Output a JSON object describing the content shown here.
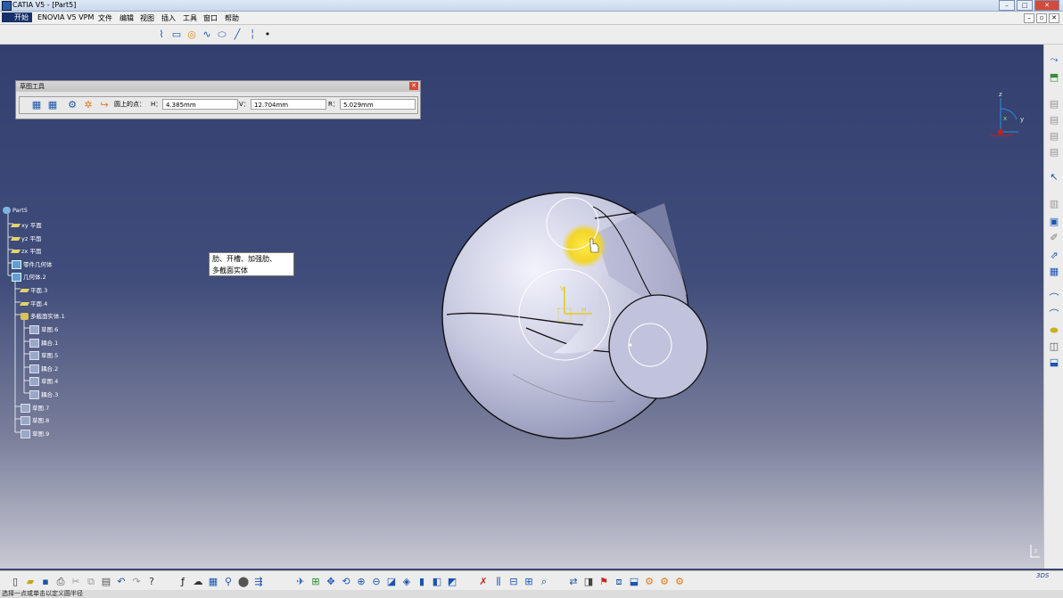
{
  "window": {
    "title": "CATIA V5 - [Part5]"
  },
  "menu": {
    "start": "开始",
    "items": [
      "ENOVIA V5 VPM",
      "文件",
      "编辑",
      "视图",
      "插入",
      "工具",
      "窗口",
      "帮助"
    ]
  },
  "sketch_tools": {
    "title": "草图工具",
    "point_label": "圆上的点：",
    "h_label": "H：",
    "h_value": "4.385mm",
    "v_label": "V：",
    "v_value": "12.704mm",
    "r_label": "R：",
    "r_value": "5.029mm"
  },
  "tree": [
    {
      "label": "Part5",
      "icon": "part-icon"
    },
    {
      "label": "xy 平面",
      "icon": "plane-icon"
    },
    {
      "label": "yz 平面",
      "icon": "plane-icon"
    },
    {
      "label": "zx 平面",
      "icon": "plane-icon"
    },
    {
      "label": "零件几何体",
      "icon": "body-icon"
    },
    {
      "label": "几何体.2",
      "icon": "body-icon"
    },
    {
      "label": "平面.3",
      "icon": "plane-icon"
    },
    {
      "label": "平面.4",
      "icon": "plane-icon"
    },
    {
      "label": "多截面实体.1",
      "icon": "multisection-icon"
    },
    {
      "label": "草图.6",
      "icon": "sketch-icon"
    },
    {
      "label": "耦合.1",
      "icon": "coupling-icon"
    },
    {
      "label": "草图.5",
      "icon": "sketch-icon"
    },
    {
      "label": "耦合.2",
      "icon": "coupling-icon"
    },
    {
      "label": "草图.4",
      "icon": "sketch-icon"
    },
    {
      "label": "耦合.3",
      "icon": "coupling-icon"
    },
    {
      "label": "草图.7",
      "icon": "sketch-icon"
    },
    {
      "label": "草图.8",
      "icon": "sketch-icon"
    },
    {
      "label": "草图.9",
      "icon": "sketch-icon"
    }
  ],
  "tooltip": {
    "line1": "肋、开槽、加强肋、",
    "line2": "多截面实体"
  },
  "compass_axes": {
    "x": "x",
    "y": "y",
    "z": "z"
  },
  "status": {
    "text": "选择一点或单击以定义圆半径"
  },
  "colors": {
    "background_top": "#333f6e",
    "background_bottom": "#c9c9d4",
    "part": "#c7c9e0",
    "highlight": "#f5e63a",
    "sketch_axis": "#e7c820"
  }
}
